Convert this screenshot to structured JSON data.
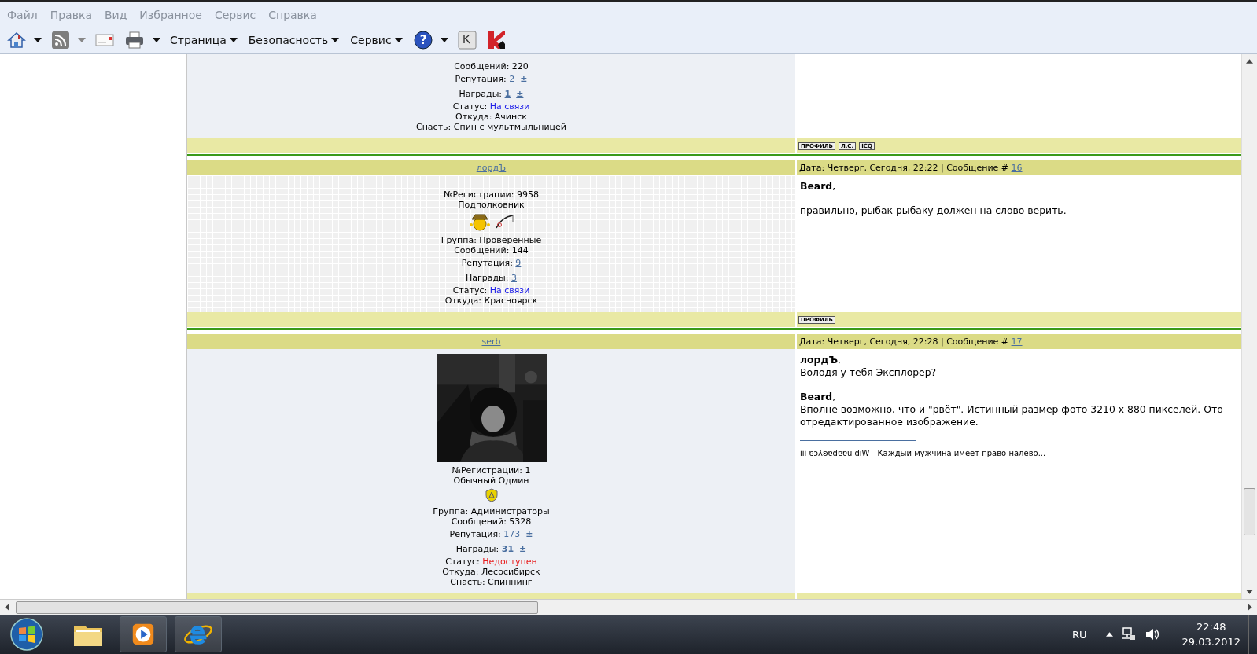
{
  "menu": [
    "Файл",
    "Правка",
    "Вид",
    "Избранное",
    "Сервис",
    "Справка"
  ],
  "toolbar": [
    {
      "kind": "home",
      "caret": true
    },
    {
      "kind": "feed",
      "caret": true
    },
    {
      "kind": "mail",
      "caret": false
    },
    {
      "kind": "print",
      "caret": true
    },
    {
      "kind": "menu",
      "label": "Страница"
    },
    {
      "kind": "menu",
      "label": "Безопасность"
    },
    {
      "kind": "menu",
      "label": "Сервис"
    },
    {
      "kind": "help",
      "glyph": "?",
      "caret": true
    },
    {
      "kind": "key",
      "caret": false
    },
    {
      "kind": "kav",
      "caret": false
    }
  ],
  "posts": [
    {
      "grid": false,
      "profile": [
        {
          "kind": "plain",
          "text": "Сообщений: 220"
        },
        {
          "kind": "link",
          "label": "Репутация:",
          "value": "2",
          "extra": "±",
          "bold": false
        },
        {
          "kind": "link",
          "label": "Награды:",
          "value": "1",
          "extra": "±",
          "bold": true
        },
        {
          "kind": "status",
          "label": "Статус:",
          "value": "На связи",
          "online": true
        },
        {
          "kind": "plain",
          "text": "Откуда: Ачинск"
        },
        {
          "kind": "plain",
          "text": "Снасть: Спин с мультмыльницей"
        }
      ],
      "buttons": [
        "ПРОФИЛЬ",
        "Л.С.",
        "ICQ"
      ]
    },
    {
      "author": "лордЪ",
      "date": "Дата: Четверг, Сегодня, 22:22 | Сообщение #",
      "number": "16",
      "grid": true,
      "profile": [
        {
          "kind": "plain",
          "text": "№Регистрации: 9958"
        },
        {
          "kind": "plain",
          "text": "Подполковник"
        },
        {
          "kind": "angler-icons"
        },
        {
          "kind": "plain",
          "text": "Группа: Проверенные"
        },
        {
          "kind": "plain",
          "text": "Сообщений: 144"
        },
        {
          "kind": "link",
          "label": "Репутация:",
          "value": "9",
          "bold": false
        },
        {
          "kind": "link",
          "label": "Награды:",
          "value": "3",
          "bold": false
        },
        {
          "kind": "status",
          "label": "Статус:",
          "value": "На связи",
          "online": true
        },
        {
          "kind": "plain",
          "text": "Откуда: Красноярск"
        }
      ],
      "buttons": [
        "ПРОФИЛЬ"
      ],
      "body": [
        [
          "**Beard**,"
        ],
        [
          "правильно, рыбак рыбаку должен на слово верить."
        ]
      ]
    },
    {
      "author": "serb",
      "date": "Дата: Четверг, Сегодня, 22:28 | Сообщение #",
      "number": "17",
      "grid": false,
      "avatar": {
        "kind": "picture"
      },
      "profile": [
        {
          "kind": "plain",
          "text": "№Регистрации: 1"
        },
        {
          "kind": "plain",
          "text": "Обычный Одмин"
        },
        {
          "kind": "admin-icon"
        },
        {
          "kind": "plain",
          "text": "Группа: Администраторы"
        },
        {
          "kind": "plain",
          "text": "Сообщений: 5328"
        },
        {
          "kind": "link",
          "label": "Репутация:",
          "value": "173",
          "extra": "±",
          "bold": false
        },
        {
          "kind": "link",
          "label": "Награды:",
          "value": "31",
          "extra": "±",
          "bold": true
        },
        {
          "kind": "status",
          "label": "Статус:",
          "value": "Недоступен",
          "online": false
        },
        {
          "kind": "plain",
          "text": "Откуда: Лесосибирск"
        },
        {
          "kind": "plain",
          "text": "Снасть: Спиннинг"
        }
      ],
      "body": [
        [
          "**лордЪ**,",
          "Володя у тебя Эксплорер?"
        ],
        [
          "**Beard**,",
          "Вполне возможно, что и \"рвёт\". Истинный размер фото 3210 x 880 пикселей. Ото",
          "отредактированное изображение."
        ]
      ],
      "signature": "iii ɐɔʎʚɐdɐɐu dıW - Каждый мужчина имеет право налево..."
    }
  ],
  "tray": {
    "language": "RU",
    "time": "22:48",
    "date": "29.03.2012"
  }
}
